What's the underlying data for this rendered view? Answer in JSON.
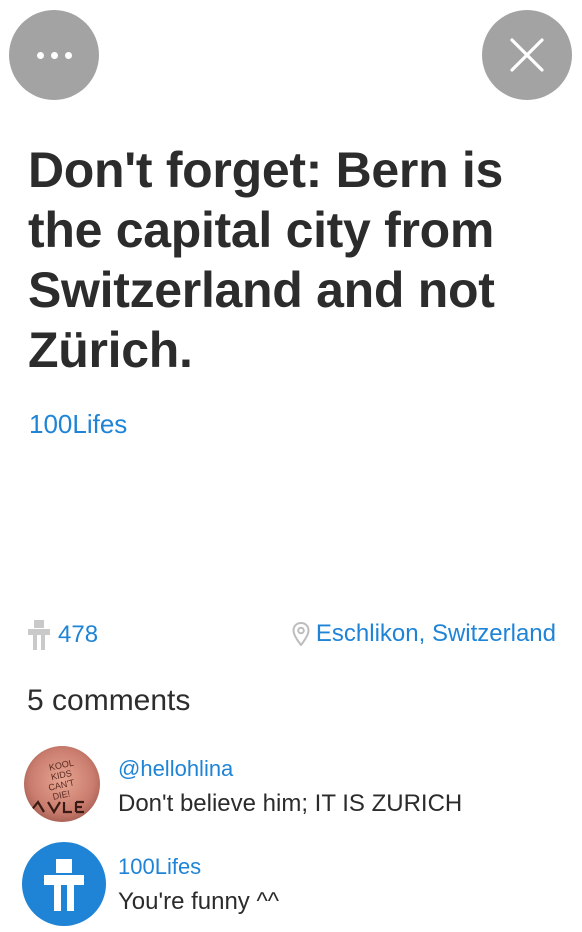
{
  "header": {
    "more_icon": "ellipsis-icon",
    "close_icon": "close-icon"
  },
  "post": {
    "title": "Don't forget: Bern is the capital city from Switzerland and not Zürich.",
    "author": "100Lifes",
    "likes": "478",
    "location": "Eschlikon, Switzerland"
  },
  "comments": {
    "heading": "5 comments",
    "items": [
      {
        "user": "@hellohlina",
        "text": "Don't believe him; IT IS ZURICH",
        "avatar_text": "KOOL KIDS CAN'T DIE!"
      },
      {
        "user": "100Lifes",
        "text": "You're funny ^^"
      }
    ]
  },
  "colors": {
    "accent": "#1f84d6",
    "button_bg": "#a3a3a3",
    "text": "#2b2b2b"
  }
}
